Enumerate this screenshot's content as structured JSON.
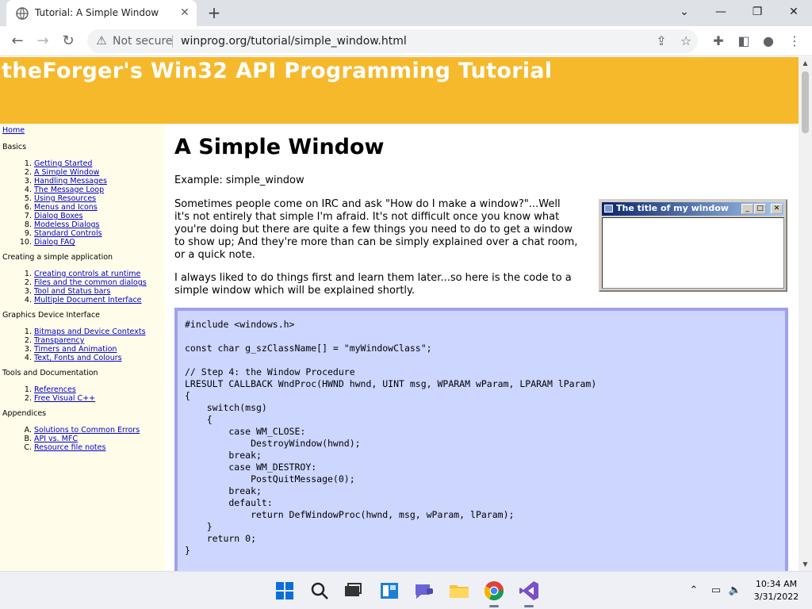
{
  "browser": {
    "tab_title": "Tutorial: A Simple Window",
    "tab_close": "✕",
    "new_tab": "+",
    "security_label": "Not secure",
    "url": "winprog.org/tutorial/simple_window.html"
  },
  "page": {
    "banner_title": "theForger's Win32 API Programming Tutorial",
    "heading": "A Simple Window",
    "example_line": "Example: simple_window",
    "para1": [
      "Sometimes people come on IRC and ask \"How do I make a window?\"...Well",
      "it's not entirely that simple I'm afraid. It's not difficult once you know what",
      "you're doing but there are quite a few things you need to do to get a window",
      "to show up; And they're more than can be simply explained over a chat room,",
      "or a quick note."
    ],
    "para2": [
      "I always liked to do things first and learn them later...so here is the code to a",
      "simple window which will be explained shortly."
    ],
    "sample_window_title": "The title of my window",
    "code": "#include <windows.h>\n\nconst char g_szClassName[] = \"myWindowClass\";\n\n// Step 4: the Window Procedure\nLRESULT CALLBACK WndProc(HWND hwnd, UINT msg, WPARAM wParam, LPARAM lParam)\n{\n    switch(msg)\n    {\n        case WM_CLOSE:\n            DestroyWindow(hwnd);\n        break;\n        case WM_DESTROY:\n            PostQuitMessage(0);\n        break;\n        default:\n            return DefWindowProc(hwnd, msg, wParam, lParam);\n    }\n    return 0;\n}"
  },
  "sidebar": {
    "home": "Home",
    "sections": [
      {
        "title": "Basics",
        "items": [
          {
            "num": "1.",
            "label": "Getting Started"
          },
          {
            "num": "2.",
            "label": "A Simple Window"
          },
          {
            "num": "3.",
            "label": "Handling Messages"
          },
          {
            "num": "4.",
            "label": "The Message Loop"
          },
          {
            "num": "5.",
            "label": "Using Resources"
          },
          {
            "num": "6.",
            "label": "Menus and Icons"
          },
          {
            "num": "7.",
            "label": "Dialog Boxes"
          },
          {
            "num": "8.",
            "label": "Modeless Dialogs"
          },
          {
            "num": "9.",
            "label": "Standard Controls"
          },
          {
            "num": "10.",
            "label": "Dialog FAQ"
          }
        ]
      },
      {
        "title": "Creating a simple application",
        "items": [
          {
            "num": "1.",
            "label": "Creating controls at runtime"
          },
          {
            "num": "2.",
            "label": "Files and the common dialogs"
          },
          {
            "num": "3.",
            "label": "Tool and Status bars"
          },
          {
            "num": "4.",
            "label": "Multiple Document Interface"
          }
        ]
      },
      {
        "title": "Graphics Device Interface",
        "items": [
          {
            "num": "1.",
            "label": "Bitmaps and Device Contexts"
          },
          {
            "num": "2.",
            "label": "Transparency"
          },
          {
            "num": "3.",
            "label": "Timers and Animation"
          },
          {
            "num": "4.",
            "label": "Text, Fonts and Colours"
          }
        ]
      },
      {
        "title": "Tools and Documentation",
        "items": [
          {
            "num": "1.",
            "label": "References"
          },
          {
            "num": "2.",
            "label": "Free Visual C++"
          }
        ]
      },
      {
        "title": "Appendices",
        "items": [
          {
            "num": "A.",
            "label": "Solutions to Common Errors"
          },
          {
            "num": "B.",
            "label": "API vs. MFC"
          },
          {
            "num": "C.",
            "label": "Resource file notes"
          }
        ]
      }
    ]
  },
  "taskbar": {
    "apps": [
      "windows-start-icon",
      "search-icon",
      "task-view-icon",
      "widgets-icon",
      "teams-chat-icon",
      "file-explorer-icon",
      "chrome-icon",
      "visual-studio-icon"
    ],
    "time": "10:34 AM",
    "date": "3/31/2022"
  },
  "colors": {
    "banner": "#f6b92b",
    "sidebar_bg": "#fffde9",
    "code_bg": "#ccd6ff",
    "code_border": "#9fa0ef",
    "link": "#0000cc"
  }
}
